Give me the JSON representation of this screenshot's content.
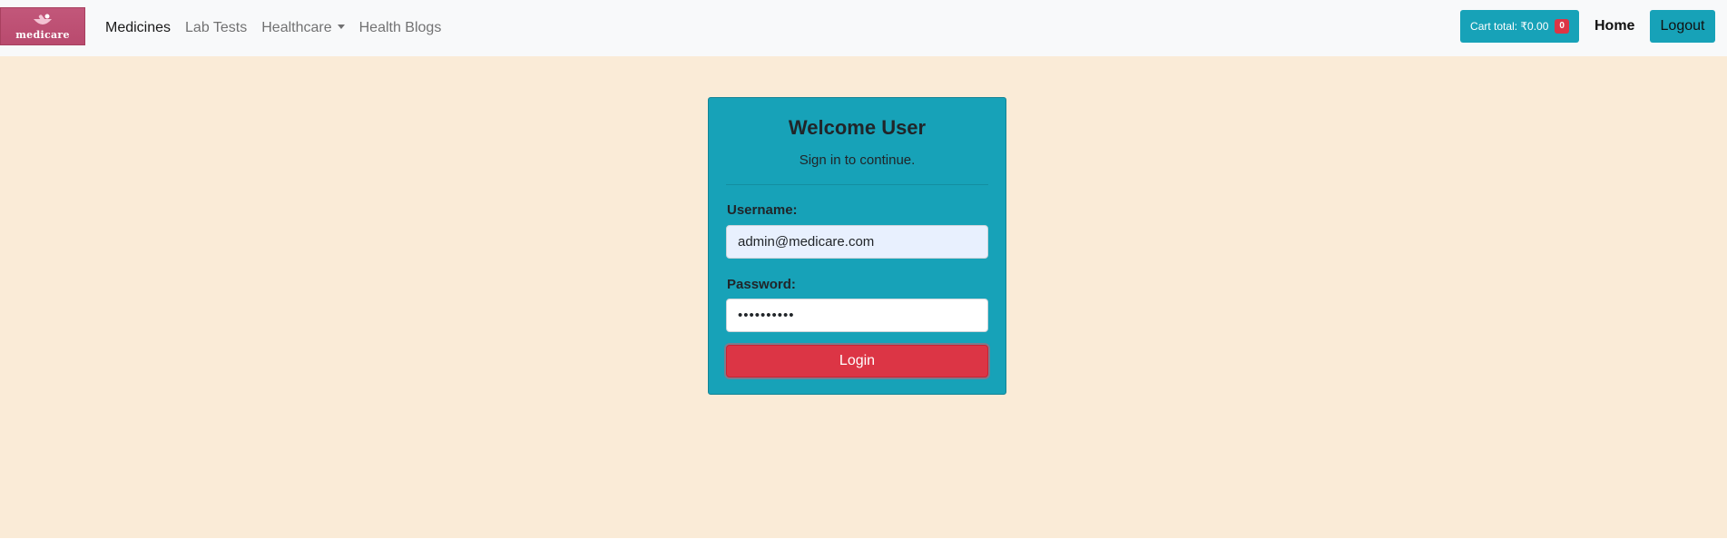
{
  "brand": {
    "name": "medicare"
  },
  "nav": {
    "links": [
      {
        "label": "Medicines",
        "active": true
      },
      {
        "label": "Lab Tests",
        "active": false
      },
      {
        "label": "Healthcare",
        "active": false,
        "dropdown": true
      },
      {
        "label": "Health Blogs",
        "active": false
      }
    ]
  },
  "cart": {
    "label": "Cart total: ₹0.00",
    "count": "0"
  },
  "header_right": {
    "home": "Home",
    "logout": "Logout"
  },
  "login": {
    "title": "Welcome User",
    "subtitle": "Sign in to continue.",
    "username_label": "Username:",
    "username_value": "admin@medicare.com",
    "password_label": "Password:",
    "password_value": "••••••••••",
    "button": "Login"
  },
  "colors": {
    "accent": "#17a2b8",
    "danger": "#dc3545",
    "background": "#faebd7",
    "navbar": "#f8f9fa",
    "brand": "#c2577a"
  },
  "icons": {
    "brand_logo": "mortar-pestle-icon",
    "dropdown": "caret-down-icon"
  }
}
